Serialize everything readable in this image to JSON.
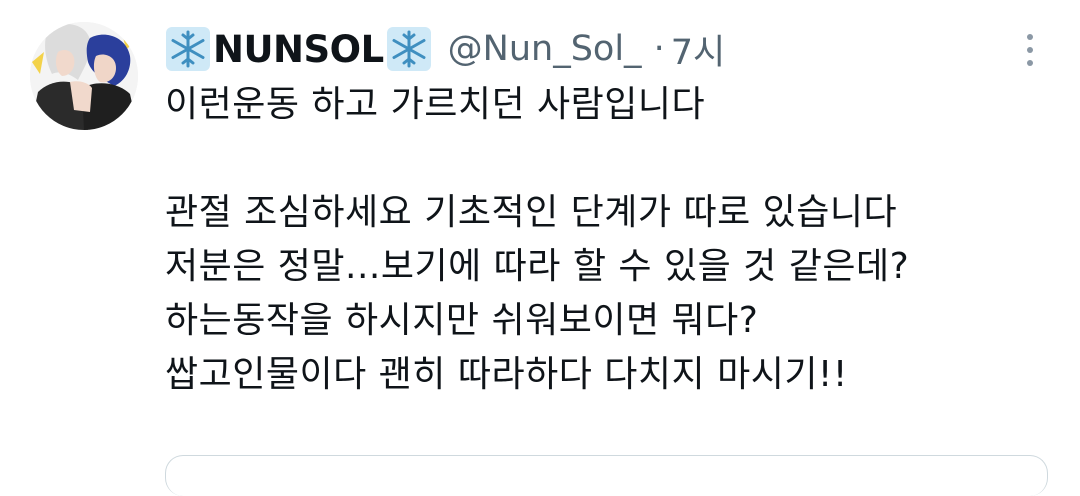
{
  "tweet": {
    "display_name": "NUNSOL",
    "name_emoji_icon": "snowflake-icon",
    "handle": "@Nun_Sol_",
    "separator": "·",
    "time": "7시",
    "text_lines": [
      "이런운동 하고 가르치던 사람입니다",
      "",
      "관절 조심하세요 기초적인 단계가 따로 있습니다",
      "저분은 정말...보기에 따라 할 수 있을 것 같은데?",
      "하는동작을 하시지만 쉬워보이면 뭐다?",
      "쌉고인물이다 괜히 따라하다 다치지 마시기!!"
    ]
  },
  "colors": {
    "text": "#0f1419",
    "secondary": "#536471",
    "snowflake": "#9ad0ec",
    "border": "#cfd9de"
  }
}
